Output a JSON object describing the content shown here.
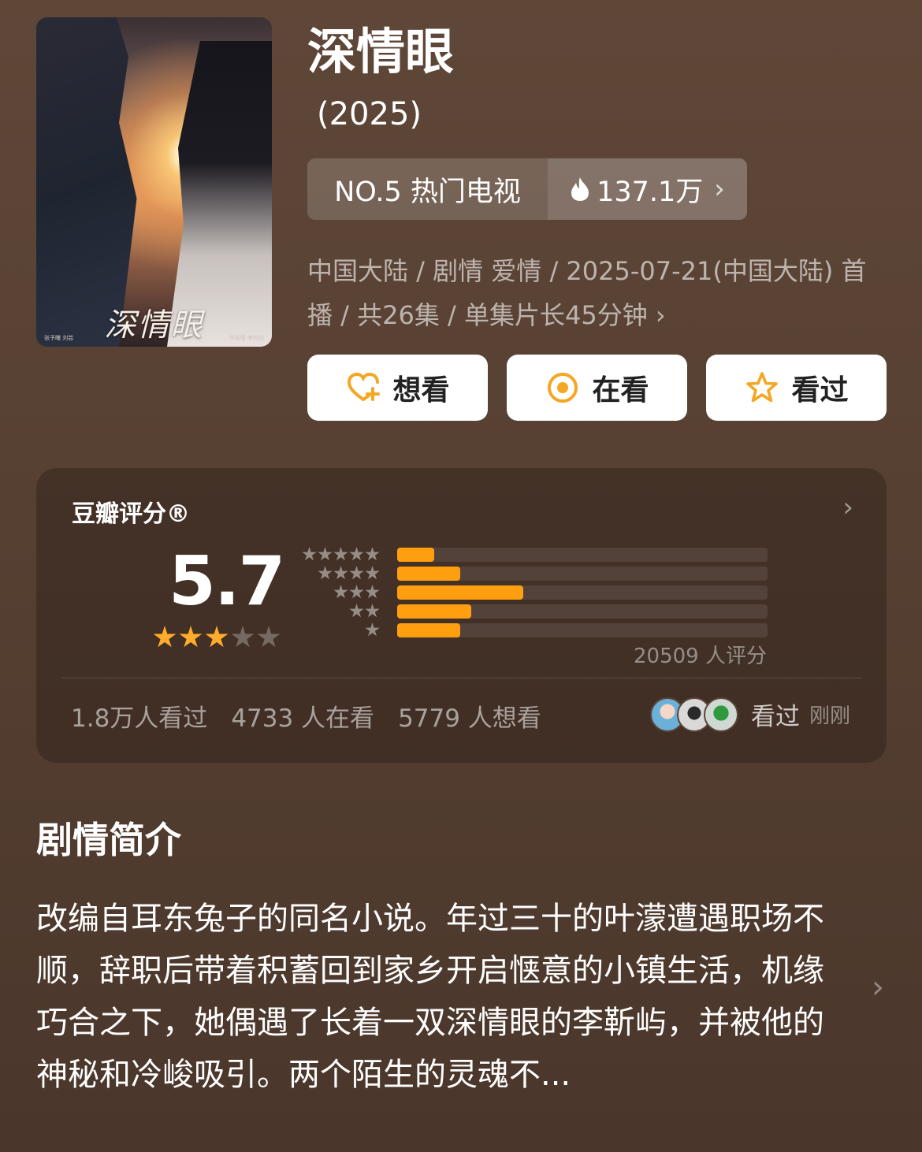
{
  "poster": {
    "title_art": "深情眼",
    "credits_left": "张予曦 刘芸",
    "credits_right": "毕雯珺 李昀锐"
  },
  "title": "深情眼",
  "year": "(2025)",
  "rank": {
    "label": "NO.5 热门电视",
    "heat": "137.1万",
    "heat_icon": "flame-icon"
  },
  "meta": {
    "text": "中国大陆 / 剧情 爱情 / 2025-07-21(中国大陆) 首播 / 共26集 / 单集片长45分钟"
  },
  "buttons": {
    "want": "想看",
    "watching": "在看",
    "watched": "看过"
  },
  "rating": {
    "label": "豆瓣评分®",
    "score": "5.7",
    "stars": 3,
    "distribution": [
      {
        "stars": 5,
        "fraction": 0.1
      },
      {
        "stars": 4,
        "fraction": 0.17
      },
      {
        "stars": 3,
        "fraction": 0.34
      },
      {
        "stars": 2,
        "fraction": 0.2
      },
      {
        "stars": 1,
        "fraction": 0.17
      }
    ],
    "count": "20509 人评分",
    "stats": {
      "watched": "1.8万人看过",
      "watching": "4733 人在看",
      "want": "5779 人想看"
    },
    "friend_action": "看过",
    "friend_time": "刚刚"
  },
  "synopsis": {
    "heading": "剧情简介",
    "text": "改编自耳东兔子的同名小说。年过三十的叶濛遭遇职场不顺，辞职后带着积蓄回到家乡开启惬意的小镇生活，机缘巧合之下，她偶遇了长着一双深情眼的李靳屿，并被他的神秘和冷峻吸引。两个陌生的灵魂不..."
  },
  "colors": {
    "accent": "#ff9f0f",
    "star": "#ffac2d",
    "background": "#5a4334"
  }
}
